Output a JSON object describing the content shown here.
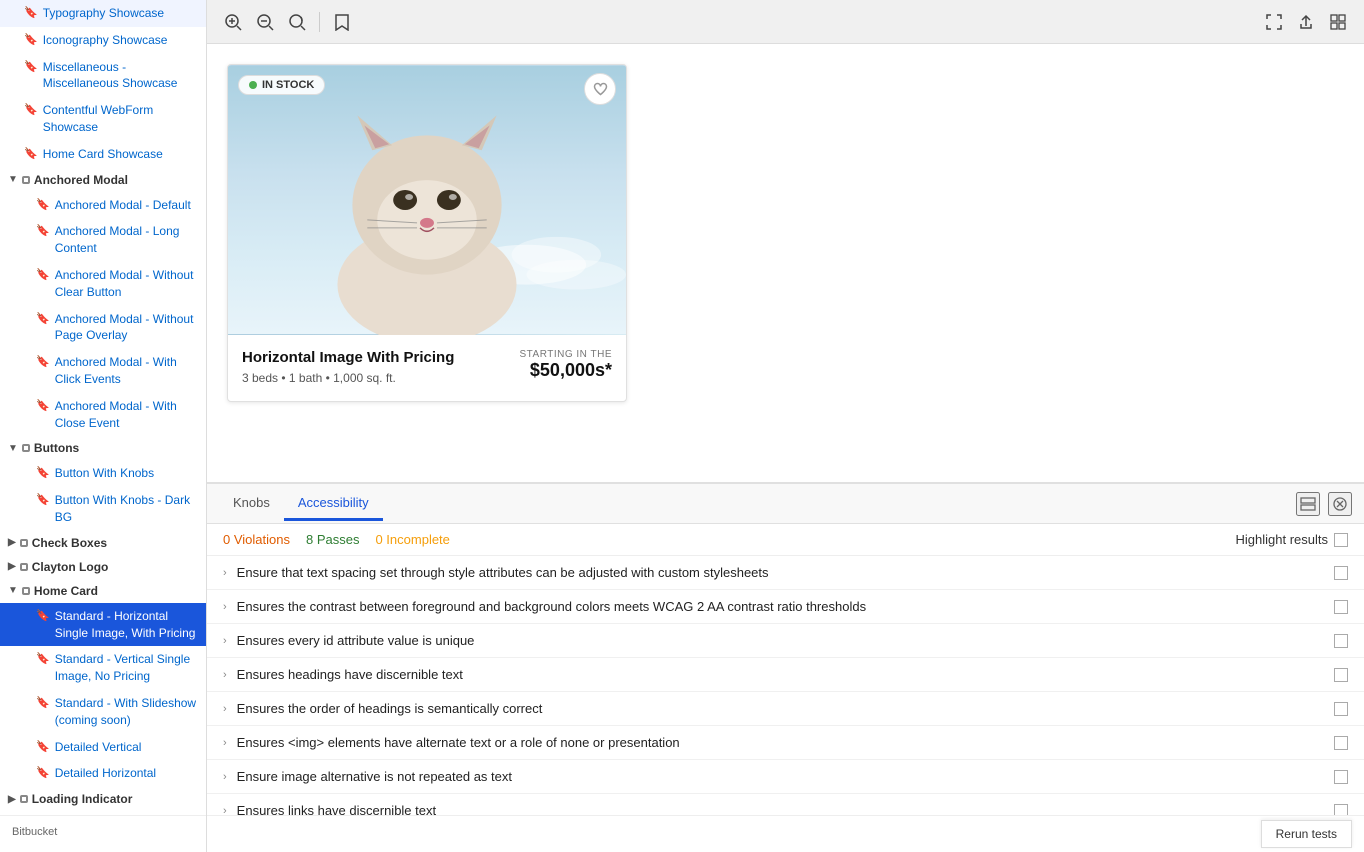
{
  "sidebar": {
    "items": [
      {
        "id": "typography-showcase",
        "label": "Typography Showcase",
        "indent": 1,
        "group": false
      },
      {
        "id": "iconography-showcase",
        "label": "Iconography Showcase",
        "indent": 1,
        "group": false
      },
      {
        "id": "miscellaneous",
        "label": "Miscellaneous - Miscellaneous Showcase",
        "indent": 1,
        "group": false
      },
      {
        "id": "contentful-webform",
        "label": "Contentful WebForm Showcase",
        "indent": 1,
        "group": false
      },
      {
        "id": "home-card-showcase",
        "label": "Home Card Showcase",
        "indent": 1,
        "group": false
      },
      {
        "id": "anchored-modal",
        "label": "Anchored Modal",
        "indent": 0,
        "group": true
      },
      {
        "id": "anchored-modal-default",
        "label": "Anchored Modal - Default",
        "indent": 2,
        "group": false
      },
      {
        "id": "anchored-modal-long",
        "label": "Anchored Modal - Long Content",
        "indent": 2,
        "group": false
      },
      {
        "id": "anchored-modal-no-clear",
        "label": "Anchored Modal - Without Clear Button",
        "indent": 2,
        "group": false
      },
      {
        "id": "anchored-modal-no-overlay",
        "label": "Anchored Modal - Without Page Overlay",
        "indent": 2,
        "group": false
      },
      {
        "id": "anchored-modal-click",
        "label": "Anchored Modal - With Click Events",
        "indent": 2,
        "group": false
      },
      {
        "id": "anchored-modal-close",
        "label": "Anchored Modal - With Close Event",
        "indent": 2,
        "group": false
      },
      {
        "id": "buttons",
        "label": "Buttons",
        "indent": 0,
        "group": true
      },
      {
        "id": "button-with-knobs",
        "label": "Button With Knobs",
        "indent": 2,
        "group": false
      },
      {
        "id": "button-with-knobs-dark",
        "label": "Button With Knobs - Dark BG",
        "indent": 2,
        "group": false
      },
      {
        "id": "check-boxes",
        "label": "Check Boxes",
        "indent": 0,
        "group": true
      },
      {
        "id": "clayton-logo",
        "label": "Clayton Logo",
        "indent": 0,
        "group": true
      },
      {
        "id": "home-card",
        "label": "Home Card",
        "indent": 0,
        "group": true
      },
      {
        "id": "standard-horizontal",
        "label": "Standard - Horizontal Single Image, With Pricing",
        "indent": 2,
        "group": false,
        "active": true
      },
      {
        "id": "standard-vertical",
        "label": "Standard - Vertical Single Image, No Pricing",
        "indent": 2,
        "group": false
      },
      {
        "id": "standard-slideshow",
        "label": "Standard - With Slideshow (coming soon)",
        "indent": 2,
        "group": false
      },
      {
        "id": "detailed-vertical",
        "label": "Detailed Vertical",
        "indent": 2,
        "group": false
      },
      {
        "id": "detailed-horizontal",
        "label": "Detailed Horizontal",
        "indent": 2,
        "group": false
      },
      {
        "id": "loading-indicator",
        "label": "Loading Indicator",
        "indent": 0,
        "group": true
      }
    ]
  },
  "toolbar": {
    "zoom_in": "⊕",
    "zoom_out": "⊖",
    "zoom_reset": "↺",
    "save": "🔖",
    "fullscreen": "⛶",
    "share": "↑",
    "grid": "⊞"
  },
  "card": {
    "badge": "IN STOCK",
    "title": "Horizontal Image With Pricing",
    "meta": "3 beds • 1 bath • 1,000 sq. ft.",
    "price_label": "STARTING IN THE",
    "price": "$50,000s*"
  },
  "panel": {
    "tabs": [
      {
        "id": "knobs",
        "label": "Knobs",
        "active": false
      },
      {
        "id": "accessibility",
        "label": "Accessibility",
        "active": true
      }
    ],
    "accessibility": {
      "violations": "0 Violations",
      "passes": "8 Passes",
      "incomplete": "0 Incomplete",
      "highlight_label": "Highlight results",
      "rows": [
        "Ensure that text spacing set through style attributes can be adjusted with custom stylesheets",
        "Ensures the contrast between foreground and background colors meets WCAG 2 AA contrast ratio thresholds",
        "Ensures every id attribute value is unique",
        "Ensures headings have discernible text",
        "Ensures the order of headings is semantically correct",
        "Ensures <img> elements have alternate text or a role of none or presentation",
        "Ensure image alternative is not repeated as text",
        "Ensures links have discernible text"
      ],
      "rerun_label": "Rerun tests"
    }
  },
  "colors": {
    "active_bg": "#1a56db",
    "tab_active": "#1a56db",
    "violations": "#e05c00",
    "passes": "#2e7d32",
    "incomplete": "#f59e0b"
  }
}
